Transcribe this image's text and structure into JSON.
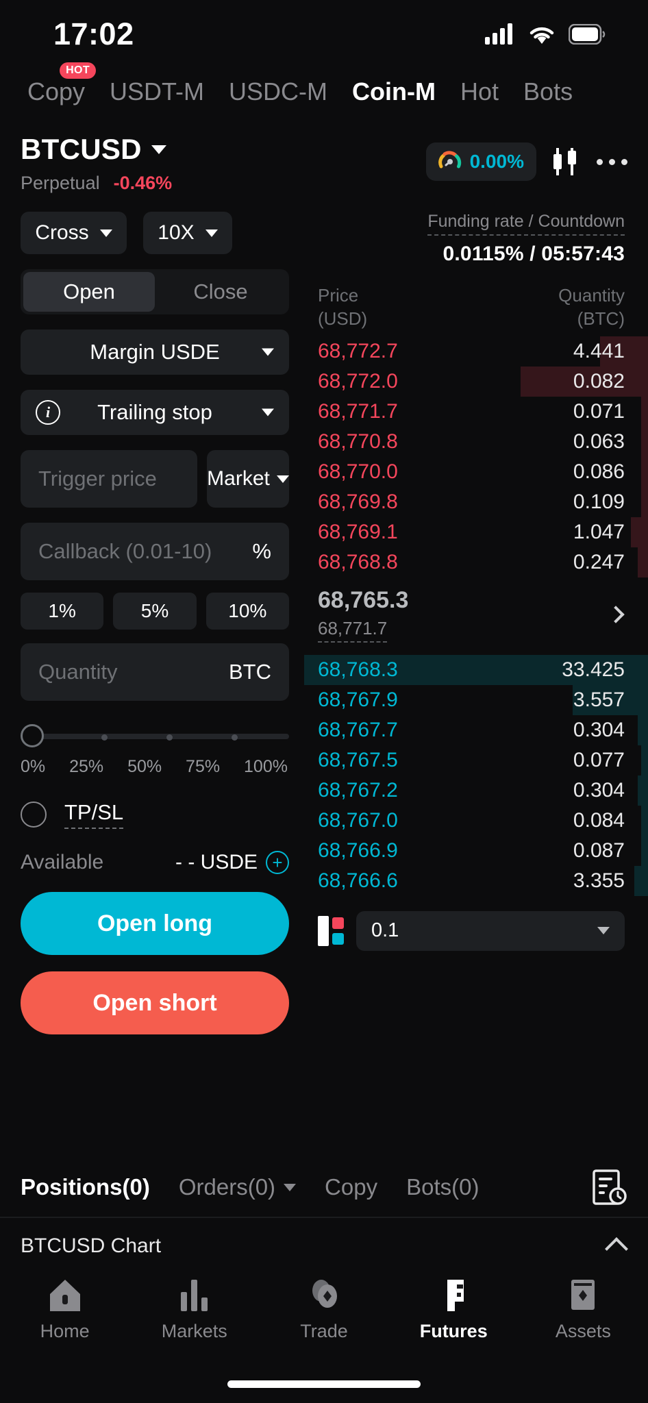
{
  "status_bar": {
    "time": "17:02",
    "signal_icon": "cellular-signal-icon",
    "wifi_icon": "wifi-icon",
    "battery_icon": "battery-icon"
  },
  "top_tabs": [
    {
      "label": "Copy",
      "active": false,
      "badge": "HOT"
    },
    {
      "label": "USDT-M",
      "active": false
    },
    {
      "label": "USDC-M",
      "active": false
    },
    {
      "label": "Coin-M",
      "active": true
    },
    {
      "label": "Hot",
      "active": false
    },
    {
      "label": "Bots",
      "active": false
    }
  ],
  "symbol": {
    "name": "BTCUSD",
    "contract_type": "Perpetual",
    "change_pct": "-0.46%",
    "gauge_pct": "0.00%",
    "gauge_icon": "gauge-icon",
    "chart_icon": "candlestick-icon",
    "more_icon": "more-dots-icon"
  },
  "order_form": {
    "margin_mode": "Cross",
    "leverage": "10X",
    "direction_tabs": [
      {
        "label": "Open",
        "active": true
      },
      {
        "label": "Close",
        "active": false
      }
    ],
    "margin_asset": "Margin USDE",
    "order_type": "Trailing stop",
    "info_icon": "info-icon",
    "trigger_price_placeholder": "Trigger price",
    "trigger_price_value": "",
    "price_mode": "Market",
    "callback_placeholder": "Callback (0.01-10)",
    "callback_value": "",
    "callback_suffix": "%",
    "callback_presets": [
      "1%",
      "5%",
      "10%"
    ],
    "quantity_placeholder": "Quantity",
    "quantity_value": "",
    "quantity_unit": "BTC",
    "slider_value": 0,
    "slider_labels": [
      "0%",
      "25%",
      "50%",
      "75%",
      "100%"
    ],
    "tpsl_label": "TP/SL",
    "tpsl_checked": false,
    "available_label": "Available",
    "available_value": "- - USDE",
    "add_funds_icon": "plus-circle-icon",
    "open_long_label": "Open long",
    "open_short_label": "Open short"
  },
  "order_book": {
    "funding_label": "Funding rate / Countdown",
    "funding_value": "0.0115% / 05:57:43",
    "col_price": "Price",
    "col_price_unit": "(USD)",
    "col_qty": "Quantity",
    "col_qty_unit": "(BTC)",
    "asks": [
      {
        "price": "68,772.7",
        "qty": "4.441",
        "depth": 14
      },
      {
        "price": "68,772.0",
        "qty": "0.082",
        "depth": 37
      },
      {
        "price": "68,771.7",
        "qty": "0.071",
        "depth": 2
      },
      {
        "price": "68,770.8",
        "qty": "0.063",
        "depth": 2
      },
      {
        "price": "68,770.0",
        "qty": "0.086",
        "depth": 2
      },
      {
        "price": "68,769.8",
        "qty": "0.109",
        "depth": 2
      },
      {
        "price": "68,769.1",
        "qty": "1.047",
        "depth": 5
      },
      {
        "price": "68,768.8",
        "qty": "0.247",
        "depth": 3
      }
    ],
    "last_price": "68,765.3",
    "mark_price": "68,771.7",
    "expand_icon": "chevron-right-icon",
    "bids": [
      {
        "price": "68,768.3",
        "qty": "33.425",
        "depth": 100
      },
      {
        "price": "68,767.9",
        "qty": "3.557",
        "depth": 22
      },
      {
        "price": "68,767.7",
        "qty": "0.304",
        "depth": 3
      },
      {
        "price": "68,767.5",
        "qty": "0.077",
        "depth": 2
      },
      {
        "price": "68,767.2",
        "qty": "0.304",
        "depth": 3
      },
      {
        "price": "68,767.0",
        "qty": "0.084",
        "depth": 2
      },
      {
        "price": "68,766.9",
        "qty": "0.087",
        "depth": 2
      },
      {
        "price": "68,766.6",
        "qty": "3.355",
        "depth": 4
      }
    ],
    "depth_icon": "orderbook-depth-icon",
    "tick_size": "0.1"
  },
  "position_tabs": [
    {
      "label": "Positions(0)",
      "active": true,
      "caret": false
    },
    {
      "label": "Orders(0)",
      "active": false,
      "caret": true
    },
    {
      "label": "Copy",
      "active": false,
      "caret": false
    },
    {
      "label": "Bots(0)",
      "active": false,
      "caret": false
    }
  ],
  "history_icon": "order-history-icon",
  "chart_bar": {
    "label": "BTCUSD  Chart",
    "collapse_icon": "chevron-up-icon"
  },
  "bottom_nav": [
    {
      "label": "Home",
      "icon": "home-icon",
      "active": false
    },
    {
      "label": "Markets",
      "icon": "markets-bars-icon",
      "active": false
    },
    {
      "label": "Trade",
      "icon": "trade-coins-icon",
      "active": false
    },
    {
      "label": "Futures",
      "icon": "futures-icon",
      "active": true
    },
    {
      "label": "Assets",
      "icon": "assets-wallet-icon",
      "active": false
    }
  ],
  "colors": {
    "accent_cyan": "#00b8d4",
    "accent_red": "#f5465c",
    "short_red": "#f55d4e",
    "bg": "#0c0c0d",
    "panel": "#1e2023"
  }
}
